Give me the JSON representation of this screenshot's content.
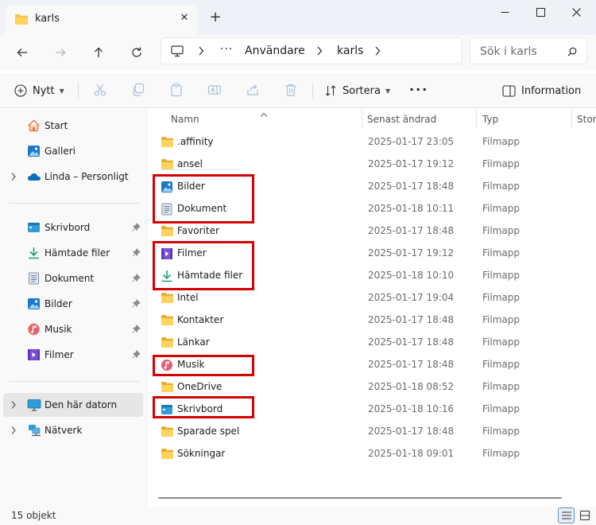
{
  "window": {
    "tab_title": "karls",
    "new_tab_symbol": "+",
    "close_tab_symbol": "✕"
  },
  "address": {
    "ellipsis": "···",
    "crumbs": [
      "Användare",
      "karls"
    ],
    "search_placeholder": "Sök i karls"
  },
  "toolbar": {
    "new_label": "Nytt",
    "sort_label": "Sortera",
    "more_label": "···",
    "info_label": "Information"
  },
  "sidebar": {
    "top": [
      {
        "label": "Start",
        "icon": "home-icon"
      },
      {
        "label": "Galleri",
        "icon": "gallery-icon"
      },
      {
        "label": "Linda – Personligt",
        "icon": "onedrive-icon"
      }
    ],
    "quick_access": [
      {
        "label": "Skrivbord",
        "icon": "desktop-icon"
      },
      {
        "label": "Hämtade filer",
        "icon": "download-icon"
      },
      {
        "label": "Dokument",
        "icon": "document-icon"
      },
      {
        "label": "Bilder",
        "icon": "pictures-icon"
      },
      {
        "label": "Musik",
        "icon": "music-icon"
      },
      {
        "label": "Filmer",
        "icon": "video-icon"
      }
    ],
    "locations": [
      {
        "label": "Den här datorn",
        "icon": "this-pc-icon",
        "selected": true
      },
      {
        "label": "Nätverk",
        "icon": "network-icon"
      }
    ]
  },
  "columns": {
    "name": "Namn",
    "modified": "Senast ändrad",
    "type": "Typ",
    "size": "Storl"
  },
  "files": [
    {
      "name": ".affinity",
      "modified": "2025-01-17 23:05",
      "type": "Filmapp",
      "icon": "folder-icon",
      "highlighted": false
    },
    {
      "name": "ansel",
      "modified": "2025-01-17 19:12",
      "type": "Filmapp",
      "icon": "folder-icon",
      "highlighted": false
    },
    {
      "name": "Bilder",
      "modified": "2025-01-17 18:48",
      "type": "Filmapp",
      "icon": "pictures-icon",
      "highlighted": true
    },
    {
      "name": "Dokument",
      "modified": "2025-01-18 10:11",
      "type": "Filmapp",
      "icon": "document-icon",
      "highlighted": true
    },
    {
      "name": "Favoriter",
      "modified": "2025-01-17 18:48",
      "type": "Filmapp",
      "icon": "folder-icon",
      "highlighted": false
    },
    {
      "name": "Filmer",
      "modified": "2025-01-17 19:12",
      "type": "Filmapp",
      "icon": "video-icon",
      "highlighted": true
    },
    {
      "name": "Hämtade filer",
      "modified": "2025-01-18 10:10",
      "type": "Filmapp",
      "icon": "download-icon",
      "highlighted": true
    },
    {
      "name": "Intel",
      "modified": "2025-01-17 19:04",
      "type": "Filmapp",
      "icon": "folder-icon",
      "highlighted": false
    },
    {
      "name": "Kontakter",
      "modified": "2025-01-17 18:48",
      "type": "Filmapp",
      "icon": "folder-icon",
      "highlighted": false
    },
    {
      "name": "Länkar",
      "modified": "2025-01-17 18:48",
      "type": "Filmapp",
      "icon": "folder-icon",
      "highlighted": false
    },
    {
      "name": "Musik",
      "modified": "2025-01-17 18:48",
      "type": "Filmapp",
      "icon": "music-icon",
      "highlighted": true
    },
    {
      "name": "OneDrive",
      "modified": "2025-01-18 08:52",
      "type": "Filmapp",
      "icon": "folder-icon",
      "highlighted": false
    },
    {
      "name": "Skrivbord",
      "modified": "2025-01-18 10:16",
      "type": "Filmapp",
      "icon": "desktop-icon",
      "highlighted": true
    },
    {
      "name": "Sparade spel",
      "modified": "2025-01-17 18:48",
      "type": "Filmapp",
      "icon": "folder-icon",
      "highlighted": false
    },
    {
      "name": "Sökningar",
      "modified": "2025-01-18 09:01",
      "type": "Filmapp",
      "icon": "folder-icon",
      "highlighted": false
    }
  ],
  "status": {
    "item_count": "15 objekt"
  },
  "colors": {
    "folder": "#f8c548",
    "highlight": "#d50000",
    "accent": "#0067c0",
    "selected_bg": "#e6e6e6"
  }
}
